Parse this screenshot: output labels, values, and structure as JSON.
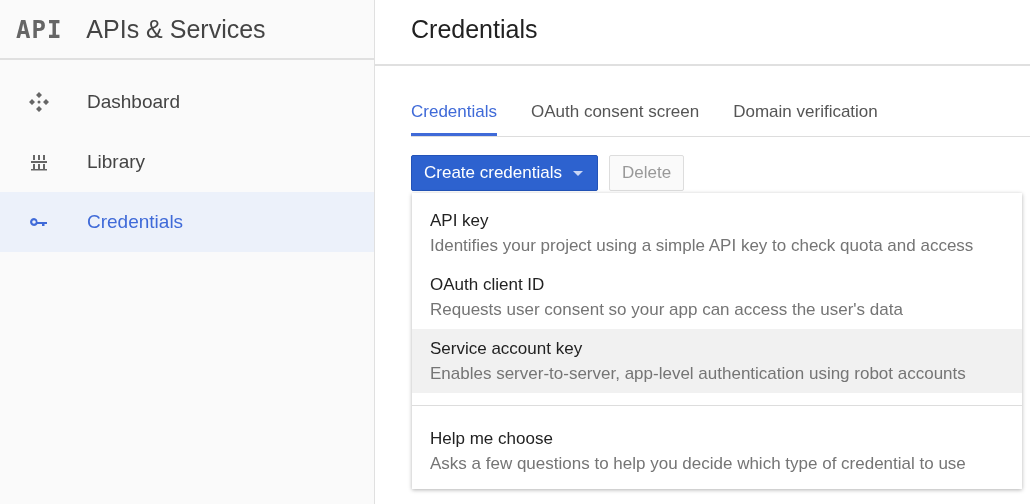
{
  "sidebar": {
    "logo": "API",
    "title": "APIs & Services",
    "items": [
      {
        "label": "Dashboard",
        "kind": "dashboard",
        "selected": false
      },
      {
        "label": "Library",
        "kind": "library",
        "selected": false
      },
      {
        "label": "Credentials",
        "kind": "key",
        "selected": true
      }
    ]
  },
  "page_title": "Credentials",
  "tabs": [
    {
      "label": "Credentials",
      "selected": true
    },
    {
      "label": "OAuth consent screen",
      "selected": false
    },
    {
      "label": "Domain verification",
      "selected": false
    }
  ],
  "toolbar": {
    "create_button": "Create credentials",
    "delete_button": {
      "label": "Delete",
      "disabled": true
    }
  },
  "menu": {
    "items": [
      {
        "kind": "option",
        "title": "API key",
        "description": "Identifies your project using a simple API key to check quota and access",
        "selected": false
      },
      {
        "kind": "option",
        "title": "OAuth client ID",
        "description": "Requests user consent so your app can access the user's data",
        "selected": false
      },
      {
        "kind": "option",
        "title": "Service account key",
        "description": "Enables server-to-server, app-level authentication using robot accounts",
        "selected": true
      },
      {
        "kind": "help",
        "title": "Help me choose",
        "description": "Asks a few questions to help you decide which type of credential to use",
        "selected": false
      }
    ]
  }
}
